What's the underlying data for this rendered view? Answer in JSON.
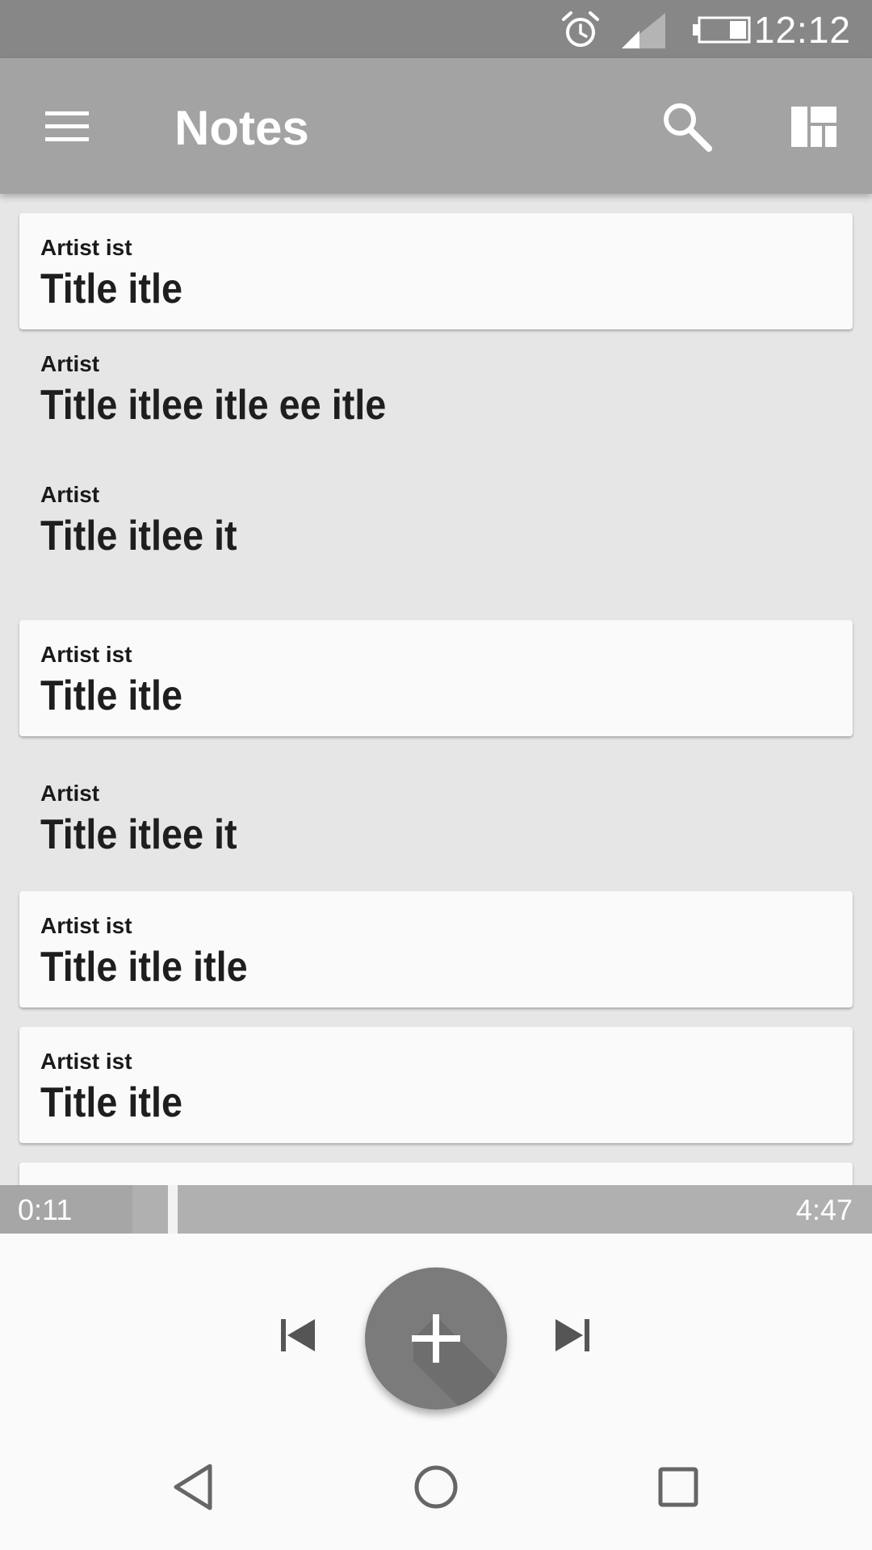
{
  "status_bar": {
    "time": "12:12",
    "icons": [
      "alarm-icon",
      "cell-signal-icon",
      "battery-icon"
    ]
  },
  "app_bar": {
    "title": "Notes",
    "icons": [
      "menu-icon",
      "search-icon",
      "dashboard-layout-icon"
    ]
  },
  "notes": [
    {
      "artist": "Artist ist",
      "title": "Title itle",
      "style": "card"
    },
    {
      "artist": "Artist",
      "title": "Title itlee itle ee itle",
      "style": "flat"
    },
    {
      "artist": "Artist",
      "title": "Title itlee it",
      "style": "flat"
    },
    {
      "artist": "Artist ist",
      "title": "Title itle",
      "style": "card"
    },
    {
      "artist": "Artist",
      "title": "Title itlee it",
      "style": "flat"
    },
    {
      "artist": "Artist ist",
      "title": "Title itle itle",
      "style": "card"
    },
    {
      "artist": "Artist ist",
      "title": "Title itle",
      "style": "card"
    },
    {
      "artist": "",
      "title": "",
      "style": "card"
    }
  ],
  "player": {
    "elapsed": "0:11",
    "duration": "4:47",
    "progress_fraction": 0.039,
    "icons": [
      "skip-previous-icon",
      "add-icon",
      "skip-next-icon"
    ]
  },
  "nav_bar": {
    "icons": [
      "back-icon",
      "home-icon",
      "recents-icon"
    ]
  },
  "colors": {
    "status_bar": "#878787",
    "app_bar": "#a3a3a3",
    "background": "#e6e6e6",
    "card": "#fafafa",
    "fab": "#7b7b7b",
    "progress_track": "#b0b0b0"
  }
}
